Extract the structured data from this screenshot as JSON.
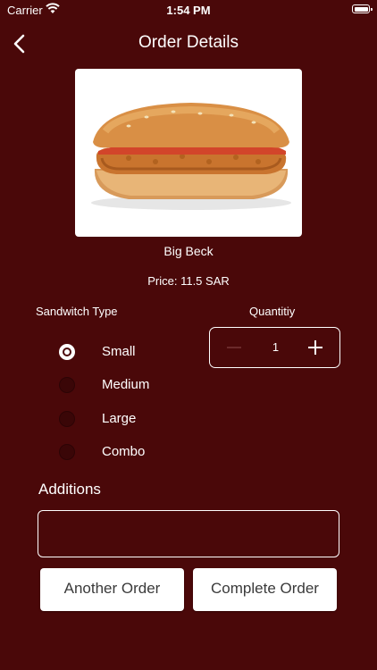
{
  "status_bar": {
    "carrier": "Carrier",
    "time": "1:54 PM"
  },
  "nav": {
    "title": "Order Details"
  },
  "product": {
    "name": "Big Beck",
    "price": "Price: 11.5 SAR"
  },
  "sandwich_type": {
    "label": "Sandwitch Type",
    "options": [
      "Small",
      "Medium",
      "Large",
      "Combo"
    ],
    "selected": "Small"
  },
  "quantity": {
    "label": "Quantitiy",
    "value": "1"
  },
  "additions": {
    "label": "Additions",
    "value": ""
  },
  "buttons": {
    "another_order": "Another Order",
    "complete_order": "Complete Order"
  },
  "colors": {
    "background": "#4a0809",
    "button_bg": "#ffffff",
    "button_text": "#3a3a3a"
  }
}
